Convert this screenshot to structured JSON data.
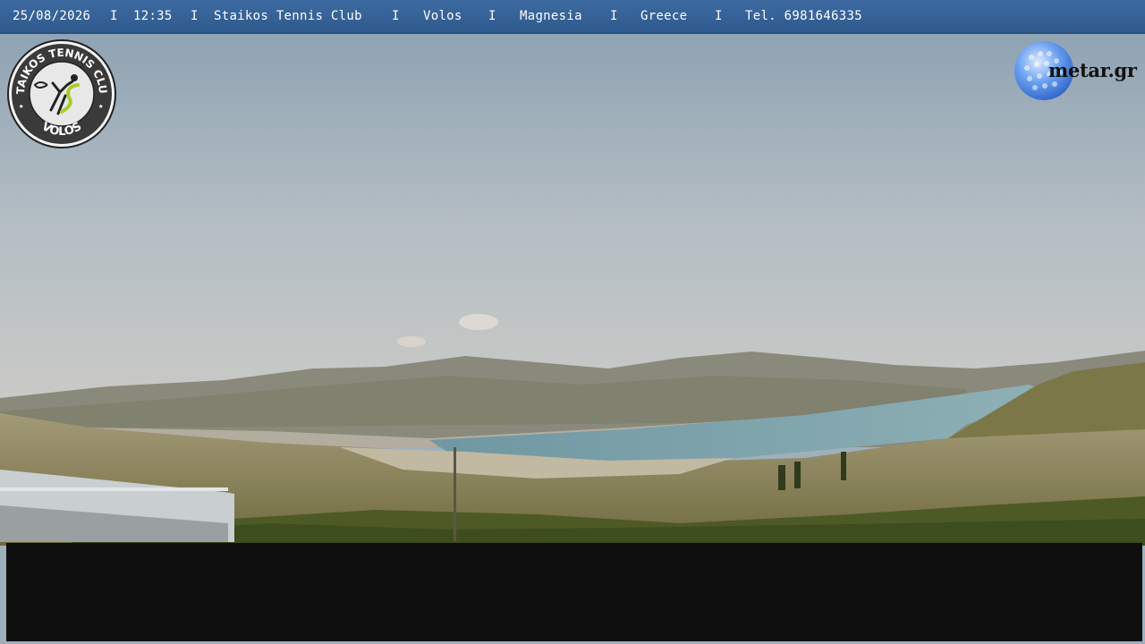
{
  "header": {
    "date": "25/08/2026",
    "time": "12:35",
    "club": "Staikos Tennis Club",
    "city": "Volos",
    "region": "Magnesia",
    "country": "Greece",
    "phone": "Tel. 6981646335",
    "separator": "I"
  },
  "logo_club": {
    "top_text": "STAIKOS TENNIS CLUB",
    "bottom_text": "VOLOS"
  },
  "logo_metar": {
    "text": "metar.gr"
  },
  "colors": {
    "header_bar": "#2f5a8e",
    "sky": "#a9b7c1",
    "sea": "#5b8791",
    "black_box": "#0f0f0f"
  }
}
